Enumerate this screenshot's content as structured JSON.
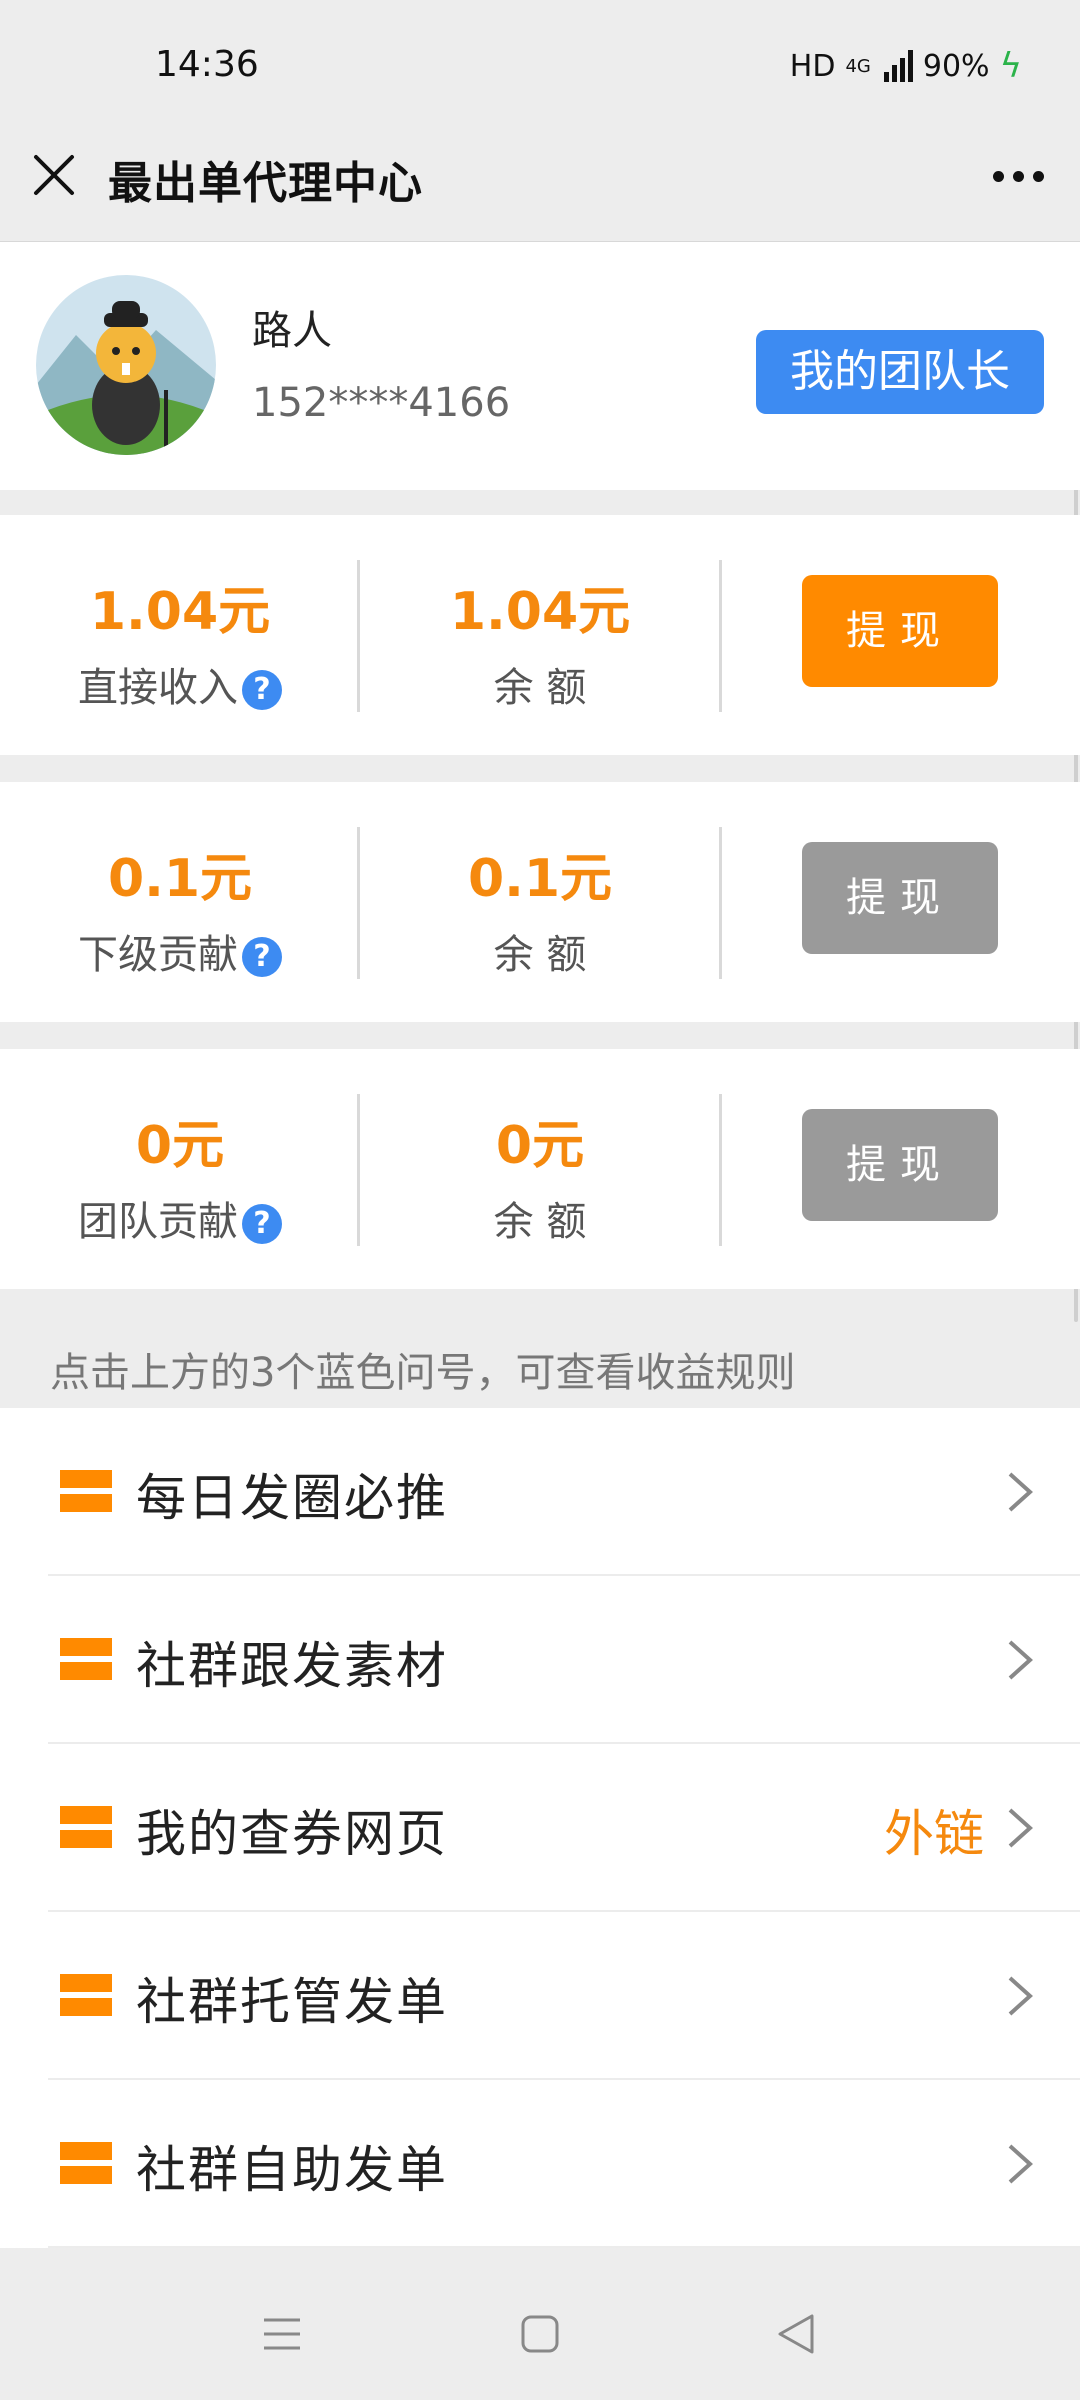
{
  "status": {
    "time": "14:36",
    "hd": "HD",
    "network": "4G",
    "battery": "90%"
  },
  "header": {
    "title": "最出单代理中心"
  },
  "profile": {
    "name": "路人",
    "phone": "152****4166",
    "team_button": "我的团队长"
  },
  "cards": [
    {
      "amount": "1.04元",
      "label": "直接收入",
      "balance": "1.04元",
      "balance_label": "余 额",
      "button": "提现",
      "button_color": "#ff8a00"
    },
    {
      "amount": "0.1元",
      "label": "下级贡献",
      "balance": "0.1元",
      "balance_label": "余 额",
      "button": "提现",
      "button_color": "#9a9a9a"
    },
    {
      "amount": "0元",
      "label": "团队贡献",
      "balance": "0元",
      "balance_label": "余 额",
      "button": "提现",
      "button_color": "#9a9a9a"
    }
  ],
  "hint": "点击上方的3个蓝色问号，可查看收益规则",
  "menu": [
    {
      "label": "每日发圈必推"
    },
    {
      "label": "社群跟发素材"
    },
    {
      "label": "我的查券网页",
      "badge": "外链"
    },
    {
      "label": "社群托管发单"
    },
    {
      "label": "社群自助发单"
    }
  ],
  "colors": {
    "accent_orange": "#f5890e",
    "accent_blue": "#3d8bf2",
    "disabled_gray": "#9a9a9a"
  }
}
